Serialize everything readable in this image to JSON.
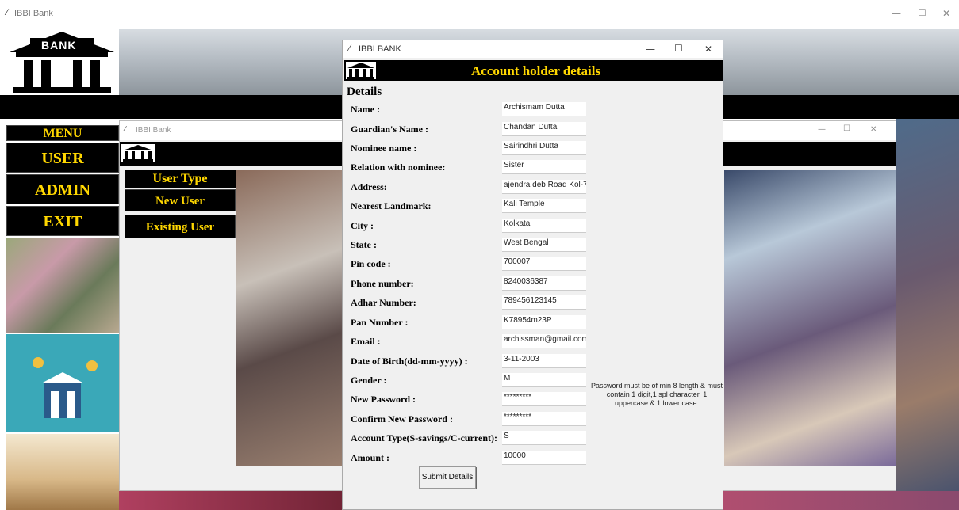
{
  "main_window": {
    "title": "IBBI Bank",
    "controls": {
      "minimize": "—",
      "maximize": "☐",
      "close": "✕"
    },
    "logo_text": "BANK"
  },
  "menu": {
    "header": "MENU",
    "items": [
      {
        "label": "USER"
      },
      {
        "label": "ADMIN"
      },
      {
        "label": "EXIT"
      }
    ]
  },
  "user_window": {
    "title": "IBBI Bank",
    "logo_text": "BANK",
    "user_type": {
      "header": "User Type",
      "options": [
        {
          "label": "New User"
        },
        {
          "label": "Existing User"
        }
      ]
    }
  },
  "details_window": {
    "title": "IBBI BANK",
    "logo_text": "BANK",
    "heading": "Account holder details",
    "section_label": "Details",
    "fields": [
      {
        "label": "Name :",
        "value": "Archismam Dutta"
      },
      {
        "label": "Guardian's Name :",
        "value": "Chandan Dutta"
      },
      {
        "label": "Nominee name :",
        "value": "Sairindhri Dutta"
      },
      {
        "label": "Relation with nominee:",
        "value": "Sister"
      },
      {
        "label": "Address:",
        "value": "ajendra deb Road Kol-7"
      },
      {
        "label": "Nearest Landmark:",
        "value": "Kali Temple"
      },
      {
        "label": "City :",
        "value": "Kolkata"
      },
      {
        "label": "State :",
        "value": "West Bengal"
      },
      {
        "label": "Pin code :",
        "value": "700007"
      },
      {
        "label": "Phone number:",
        "value": "8240036387"
      },
      {
        "label": "Adhar Number:",
        "value": "789456123145"
      },
      {
        "label": "Pan Number :",
        "value": "K78954m23P"
      },
      {
        "label": "Email :",
        "value": "archissman@gmail.com"
      },
      {
        "label": "Date of Birth(dd-mm-yyyy) :",
        "value": "3-11-2003"
      },
      {
        "label": "Gender :",
        "value": "M"
      },
      {
        "label": "New Password :",
        "value": "*********"
      },
      {
        "label": "Confirm New Password :",
        "value": "*********"
      },
      {
        "label": "Account Type(S-savings/C-current):",
        "value": "S"
      },
      {
        "label": "Amount :",
        "value": "10000"
      }
    ],
    "password_hint": "Password must be of min 8 length & must contain 1 digit,1 spl character, 1 uppercase & 1 lower case.",
    "submit_label": "Submit Details"
  },
  "colors": {
    "menu_bg": "#000000",
    "menu_text": "#ffd700",
    "heading_text": "#ffd700",
    "window_bg": "#f0f0f0"
  }
}
